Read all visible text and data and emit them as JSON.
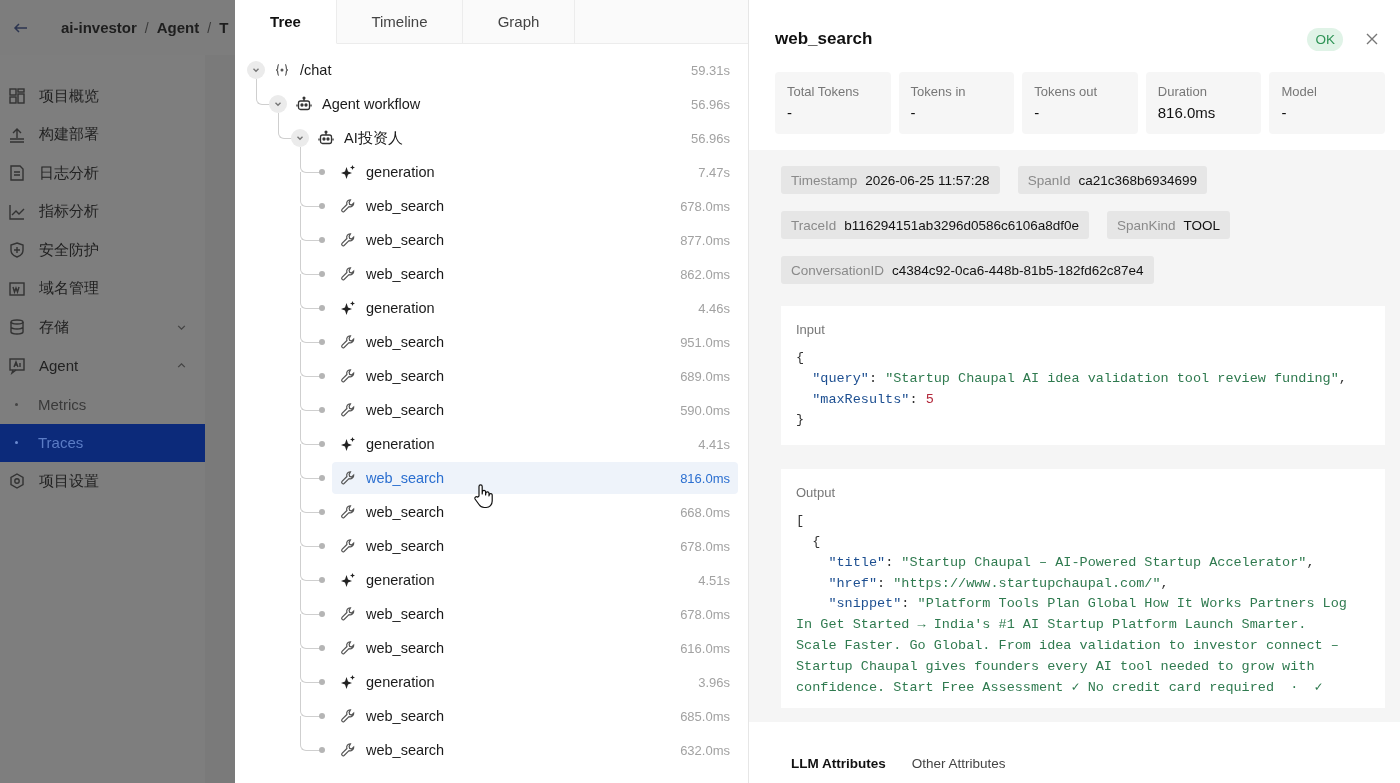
{
  "breadcrumb": {
    "items": [
      "ai-investor",
      "Agent",
      "T"
    ],
    "separator": "/"
  },
  "sidebar": {
    "items": [
      {
        "label": "项目概览",
        "selected": false
      },
      {
        "label": "构建部署",
        "selected": false
      },
      {
        "label": "日志分析",
        "selected": false
      },
      {
        "label": "指标分析",
        "selected": false
      },
      {
        "label": "安全防护",
        "selected": false
      },
      {
        "label": "域名管理",
        "selected": false
      },
      {
        "label": "存储",
        "selected": false,
        "expanded": false
      },
      {
        "label": "Agent",
        "selected": false,
        "expanded": true,
        "children": [
          {
            "label": "Metrics",
            "selected": false
          },
          {
            "label": "Traces",
            "selected": true
          }
        ]
      },
      {
        "label": "项目设置",
        "selected": false
      }
    ]
  },
  "tabs": [
    {
      "label": "Tree",
      "selected": true
    },
    {
      "label": "Timeline",
      "selected": false
    },
    {
      "label": "Graph",
      "selected": false
    }
  ],
  "tree": [
    {
      "label": "/chat",
      "duration": "59.31s",
      "kind": "endpoint",
      "selected": false,
      "expanded": true,
      "children": [
        {
          "label": "Agent workflow",
          "duration": "56.96s",
          "kind": "agent",
          "selected": false,
          "expanded": true,
          "children": [
            {
              "label": "AI投资人",
              "duration": "56.96s",
              "kind": "agent",
              "selected": false,
              "expanded": true,
              "children": [
                {
                  "label": "generation",
                  "duration": "7.47s",
                  "kind": "generation",
                  "selected": false
                },
                {
                  "label": "web_search",
                  "duration": "678.0ms",
                  "kind": "tool",
                  "selected": false
                },
                {
                  "label": "web_search",
                  "duration": "877.0ms",
                  "kind": "tool",
                  "selected": false
                },
                {
                  "label": "web_search",
                  "duration": "862.0ms",
                  "kind": "tool",
                  "selected": false
                },
                {
                  "label": "generation",
                  "duration": "4.46s",
                  "kind": "generation",
                  "selected": false
                },
                {
                  "label": "web_search",
                  "duration": "951.0ms",
                  "kind": "tool",
                  "selected": false
                },
                {
                  "label": "web_search",
                  "duration": "689.0ms",
                  "kind": "tool",
                  "selected": false
                },
                {
                  "label": "web_search",
                  "duration": "590.0ms",
                  "kind": "tool",
                  "selected": false
                },
                {
                  "label": "generation",
                  "duration": "4.41s",
                  "kind": "generation",
                  "selected": false
                },
                {
                  "label": "web_search",
                  "duration": "816.0ms",
                  "kind": "tool",
                  "selected": true
                },
                {
                  "label": "web_search",
                  "duration": "668.0ms",
                  "kind": "tool",
                  "selected": false
                },
                {
                  "label": "web_search",
                  "duration": "678.0ms",
                  "kind": "tool",
                  "selected": false
                },
                {
                  "label": "generation",
                  "duration": "4.51s",
                  "kind": "generation",
                  "selected": false
                },
                {
                  "label": "web_search",
                  "duration": "678.0ms",
                  "kind": "tool",
                  "selected": false
                },
                {
                  "label": "web_search",
                  "duration": "616.0ms",
                  "kind": "tool",
                  "selected": false
                },
                {
                  "label": "generation",
                  "duration": "3.96s",
                  "kind": "generation",
                  "selected": false
                },
                {
                  "label": "web_search",
                  "duration": "685.0ms",
                  "kind": "tool",
                  "selected": false
                },
                {
                  "label": "web_search",
                  "duration": "632.0ms",
                  "kind": "tool",
                  "selected": false
                }
              ]
            }
          ]
        }
      ]
    }
  ],
  "detail": {
    "title": "web_search",
    "status": "OK",
    "metrics": [
      {
        "label": "Total Tokens",
        "value": "-"
      },
      {
        "label": "Tokens in",
        "value": "-"
      },
      {
        "label": "Tokens out",
        "value": "-"
      },
      {
        "label": "Duration",
        "value": "816.0ms"
      },
      {
        "label": "Model",
        "value": "-"
      }
    ],
    "attributes": [
      {
        "label": "Timestamp",
        "value": "2026-06-25 11:57:28"
      },
      {
        "label": "SpanId",
        "value": "ca21c368b6934699"
      },
      {
        "label": "TraceId",
        "value": "b116294151ab3296d0586c6106a8df0e"
      },
      {
        "label": "SpanKind",
        "value": "TOOL"
      },
      {
        "label": "ConversationID",
        "value": "c4384c92-0ca6-448b-81b5-182fd62c87e4"
      }
    ],
    "input": {
      "label": "Input",
      "lines": [
        {
          "text": "{",
          "continued": false
        },
        {
          "text": "  \"query\": \"Startup Chaupal AI idea validation tool review funding\",",
          "continued": false
        },
        {
          "text": "  \"maxResults\": 5",
          "continued": false
        },
        {
          "text": "}",
          "continued": false
        }
      ]
    },
    "output": {
      "label": "Output",
      "lines": [
        {
          "text": "[",
          "continued": false
        },
        {
          "text": "  {",
          "continued": false
        },
        {
          "text": "    \"title\": \"Startup Chaupal – AI-Powered Startup Accelerator\",",
          "continued": false
        },
        {
          "text": "    \"href\": \"https://www.startupchaupal.com/\",",
          "continued": false
        },
        {
          "text": "    \"snippet\": \"Platform Tools Plan Global How It Works Partners Log",
          "continued": false
        },
        {
          "text": "In Get Started → India's #1 AI Startup Platform Launch Smarter.",
          "continued": true
        },
        {
          "text": "Scale Faster. Go Global. From idea validation to investor connect –",
          "continued": true
        },
        {
          "text": "Startup Chaupal gives founders every AI tool needed to grow with",
          "continued": true
        },
        {
          "text": "confidence. Start Free Assessment ✓ No credit card required  ·  ✓",
          "continued": true
        }
      ]
    },
    "tabs": [
      {
        "label": "LLM Attributes",
        "selected": true
      },
      {
        "label": "Other Attributes",
        "selected": false
      }
    ]
  }
}
